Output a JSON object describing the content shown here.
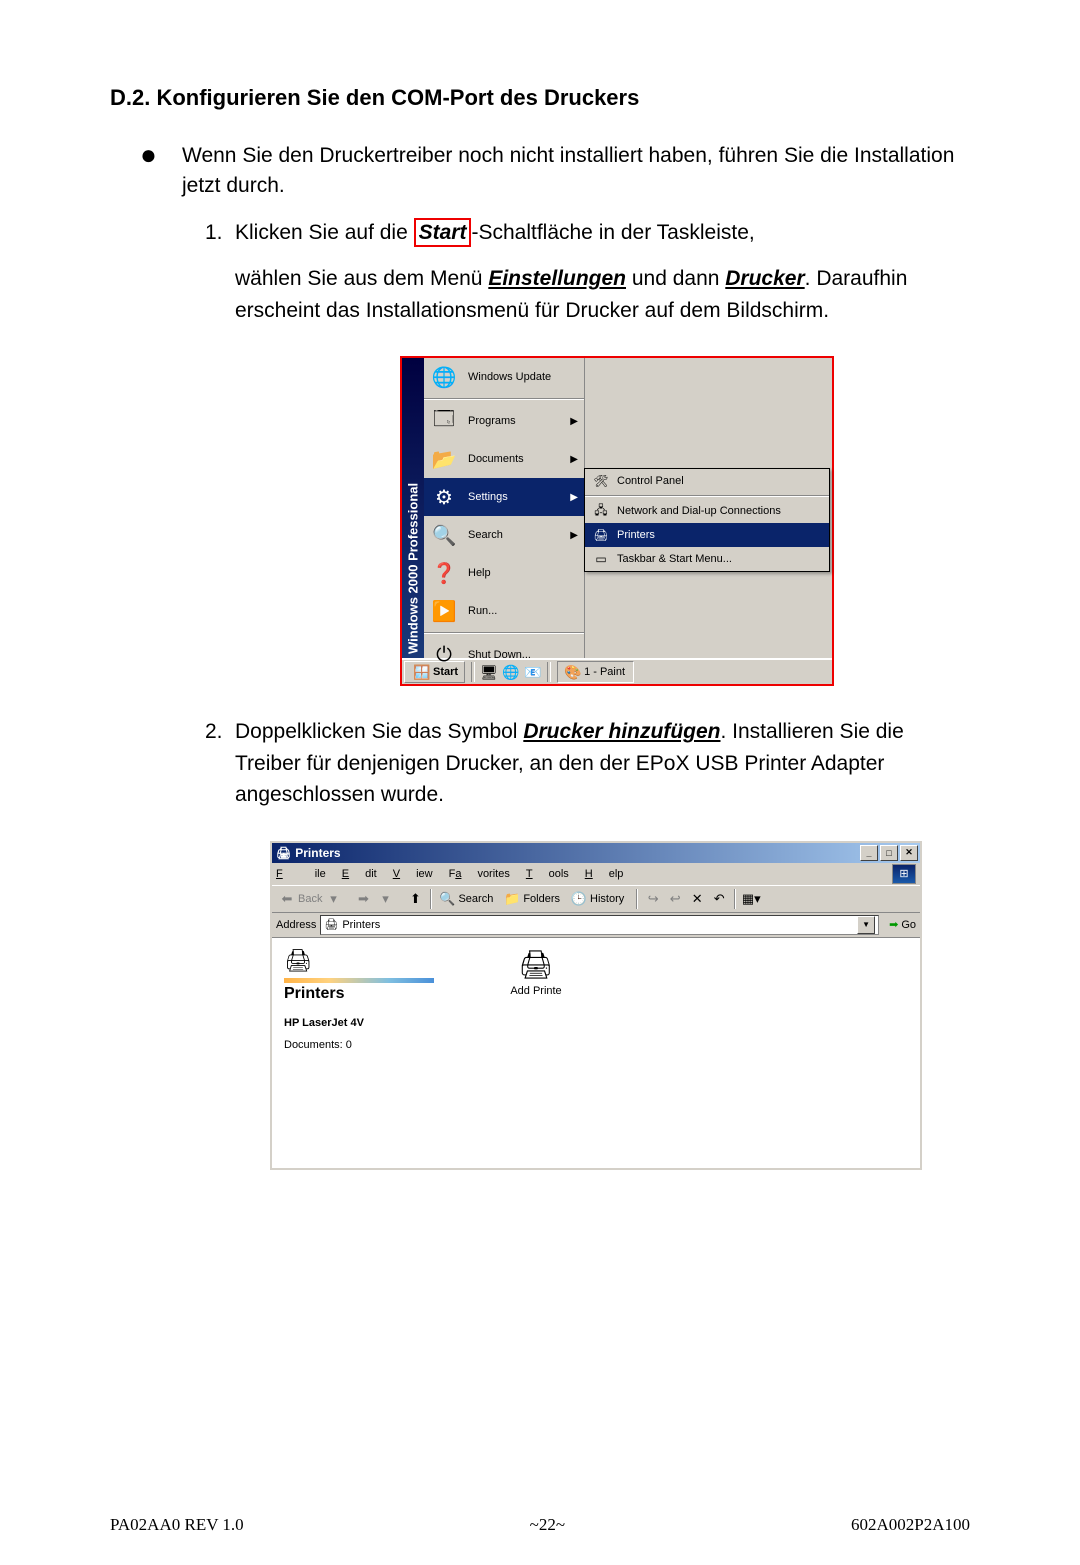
{
  "heading": "D.2. Konfigurieren Sie den COM-Port des Druckers",
  "bullet_intro": "Wenn Sie den Druckertreiber noch nicht installiert haben, führen Sie die Installation jetzt durch.",
  "step1_num": "1.",
  "step1_a": "Klicken Sie auf die ",
  "step1_start": "Start",
  "step1_b": "-Schaltfläche in der Taskleiste,",
  "step1_c_a": "wählen Sie aus dem Menü ",
  "step1_c_settings": "Einstellungen",
  "step1_c_b": " und dann ",
  "step1_c_printers": "Drucker",
  "step1_c_c": ". Daraufhin erscheint das Installationsmenü für Drucker auf dem Bildschirm.",
  "win_brand": "Windows 2000 Professional",
  "menu": {
    "update": "Windows Update",
    "programs": "Programs",
    "documents": "Documents",
    "settings": "Settings",
    "search": "Search",
    "help": "Help",
    "run": "Run...",
    "shutdown": "Shut Down..."
  },
  "submenu": {
    "cp": "Control Panel",
    "net": "Network and Dial-up Connections",
    "printers": "Printers",
    "taskbar": "Taskbar & Start Menu..."
  },
  "taskbar": {
    "start": "Start",
    "task": "1 - Paint"
  },
  "step2_num": "2.",
  "step2_a": "Doppelklicken Sie das Symbol ",
  "step2_add": "Drucker hinzufügen",
  "step2_b": ". Installieren Sie die Treiber für denjenigen Drucker, an den der EPoX USB Printer Adapter angeschlossen wurde.",
  "printers_win": {
    "title": "Printers",
    "menu_file": "File",
    "menu_edit": "Edit",
    "menu_view": "View",
    "menu_fav": "Favorites",
    "menu_tools": "Tools",
    "menu_help": "Help",
    "back": "Back",
    "search": "Search",
    "folders": "Folders",
    "history": "History",
    "address_label": "Address",
    "address_value": "Printers",
    "go": "Go",
    "panel_title": "Printers",
    "panel_sub": "HP LaserJet 4V",
    "panel_info": "Documents: 0",
    "add_printer": "Add Printe"
  },
  "footer": {
    "left": "PA02AA0   REV 1.0",
    "center": "~22~",
    "right": "602A002P2A100"
  }
}
